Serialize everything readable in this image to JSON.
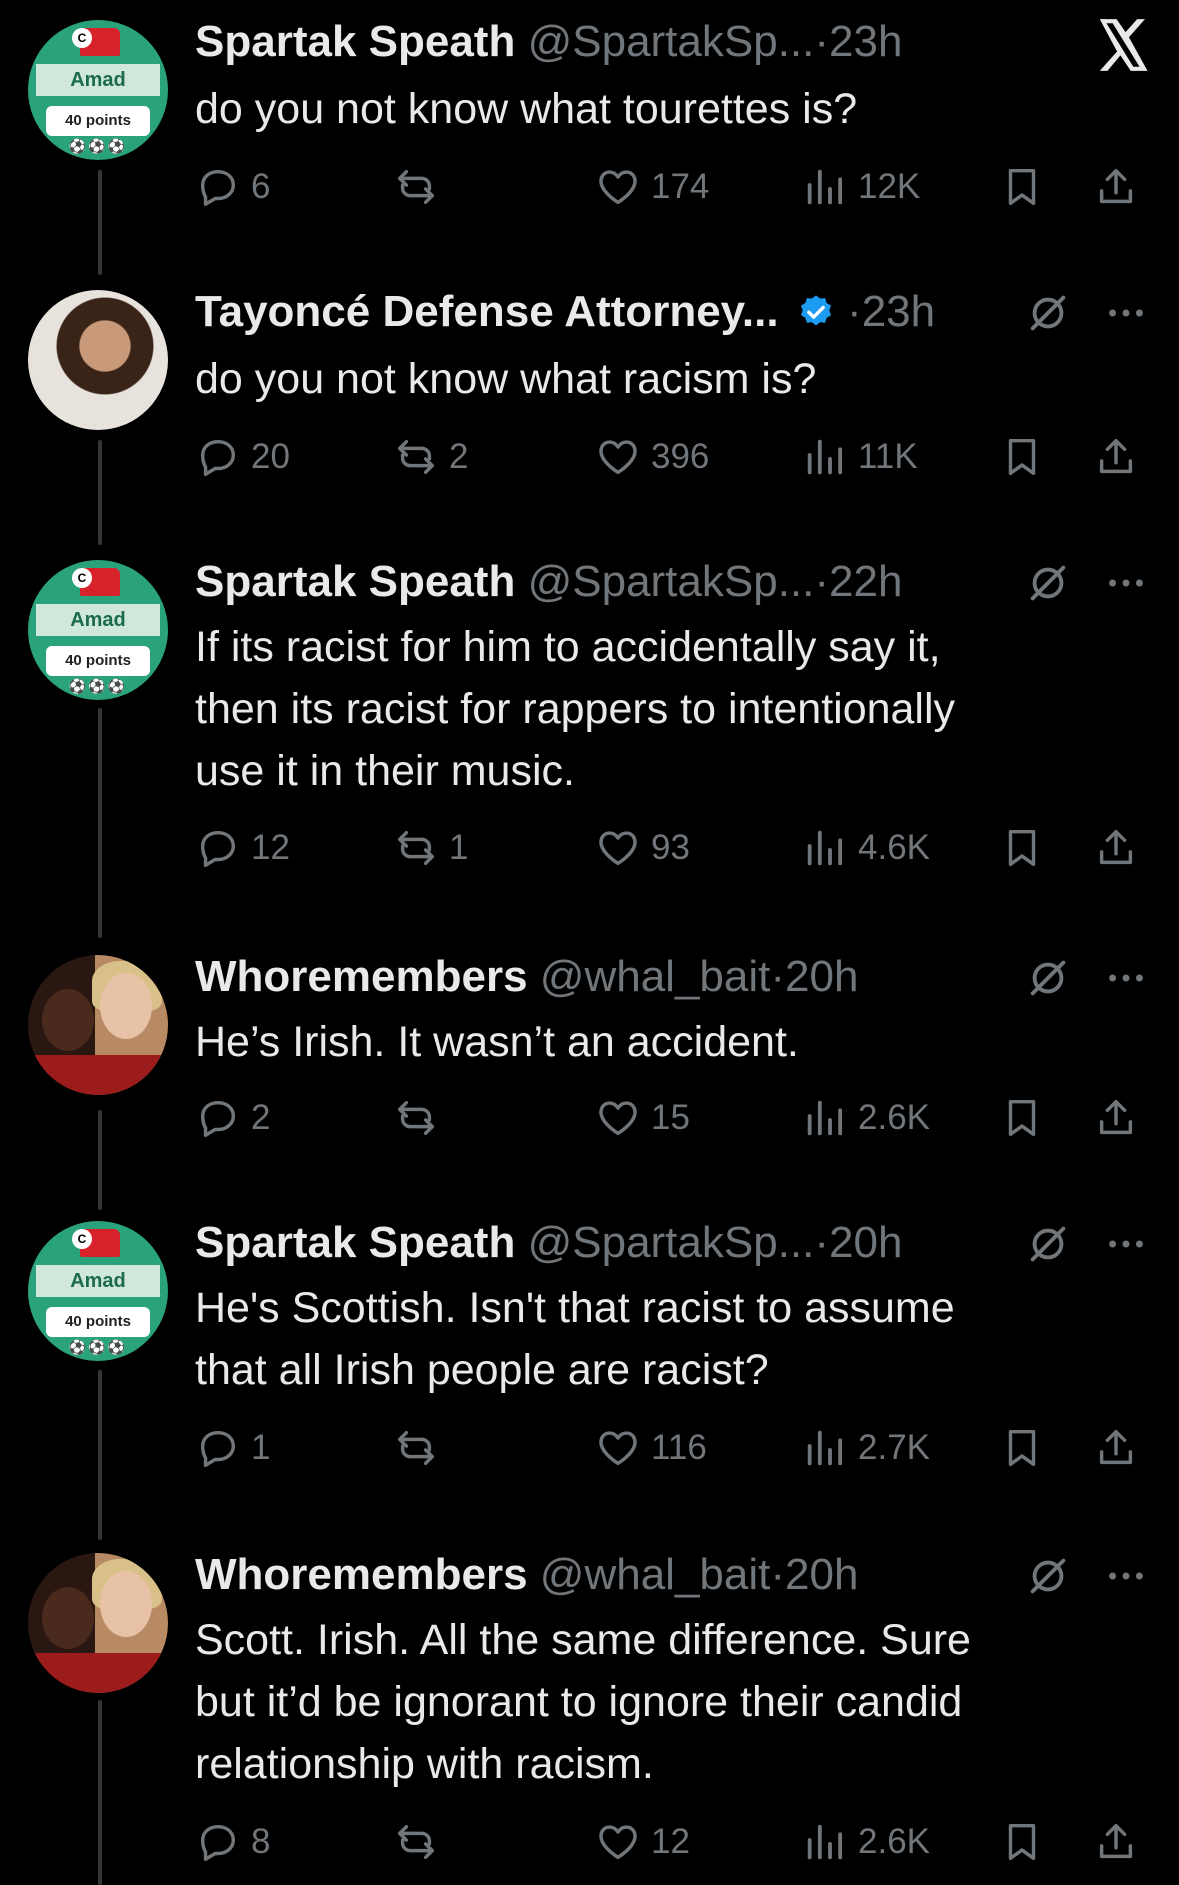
{
  "brand": {
    "logo_icon": "x-logo-icon"
  },
  "tweets": [
    {
      "author": "Spartak Speath",
      "handle": "@SpartakSp...",
      "sep": "·",
      "time": "23h",
      "text": "do you not know what tourettes is?",
      "verified": false,
      "avatar": "amad",
      "avatar_labels": {
        "badge": "C",
        "name": "Amad",
        "points": "40 points",
        "balls": "⚽⚽⚽"
      },
      "replies": "6",
      "reposts": "",
      "likes": "174",
      "views": "12K"
    },
    {
      "author": "Tayoncé Defense Attorney...",
      "handle": "",
      "sep": "·",
      "time": "23h",
      "text": "do you not know what racism is?",
      "verified": true,
      "avatar": "photo1",
      "replies": "20",
      "reposts": "2",
      "likes": "396",
      "views": "11K"
    },
    {
      "author": "Spartak Speath",
      "handle": "@SpartakSp...",
      "sep": "·",
      "time": "22h",
      "text": "If its racist for him to accidentally say it,\nthen its racist for rappers to intentionally\nuse it in their music.",
      "verified": false,
      "avatar": "amad",
      "avatar_labels": {
        "badge": "C",
        "name": "Amad",
        "points": "40 points",
        "balls": "⚽⚽⚽"
      },
      "replies": "12",
      "reposts": "1",
      "likes": "93",
      "views": "4.6K"
    },
    {
      "author": "Whoremembers",
      "handle": "@whal_bait",
      "sep": "·",
      "time": "20h",
      "text": "He’s Irish. It wasn’t an accident.",
      "verified": false,
      "avatar": "photo2",
      "replies": "2",
      "reposts": "",
      "likes": "15",
      "views": "2.6K"
    },
    {
      "author": "Spartak Speath",
      "handle": "@SpartakSp...",
      "sep": "·",
      "time": "20h",
      "text": "He's Scottish. Isn't that racist to assume\nthat all Irish people are racist?",
      "verified": false,
      "avatar": "amad",
      "avatar_labels": {
        "badge": "C",
        "name": "Amad",
        "points": "40 points",
        "balls": "⚽⚽⚽"
      },
      "replies": "1",
      "reposts": "",
      "likes": "116",
      "views": "2.7K"
    },
    {
      "author": "Whoremembers",
      "handle": "@whal_bait",
      "sep": "·",
      "time": "20h",
      "text": "Scott. Irish. All the same difference. Sure\nbut it’d be ignorant to ignore their candid\nrelationship with racism.",
      "verified": false,
      "avatar": "photo2",
      "replies": "8",
      "reposts": "",
      "likes": "12",
      "views": "2.6K"
    }
  ]
}
